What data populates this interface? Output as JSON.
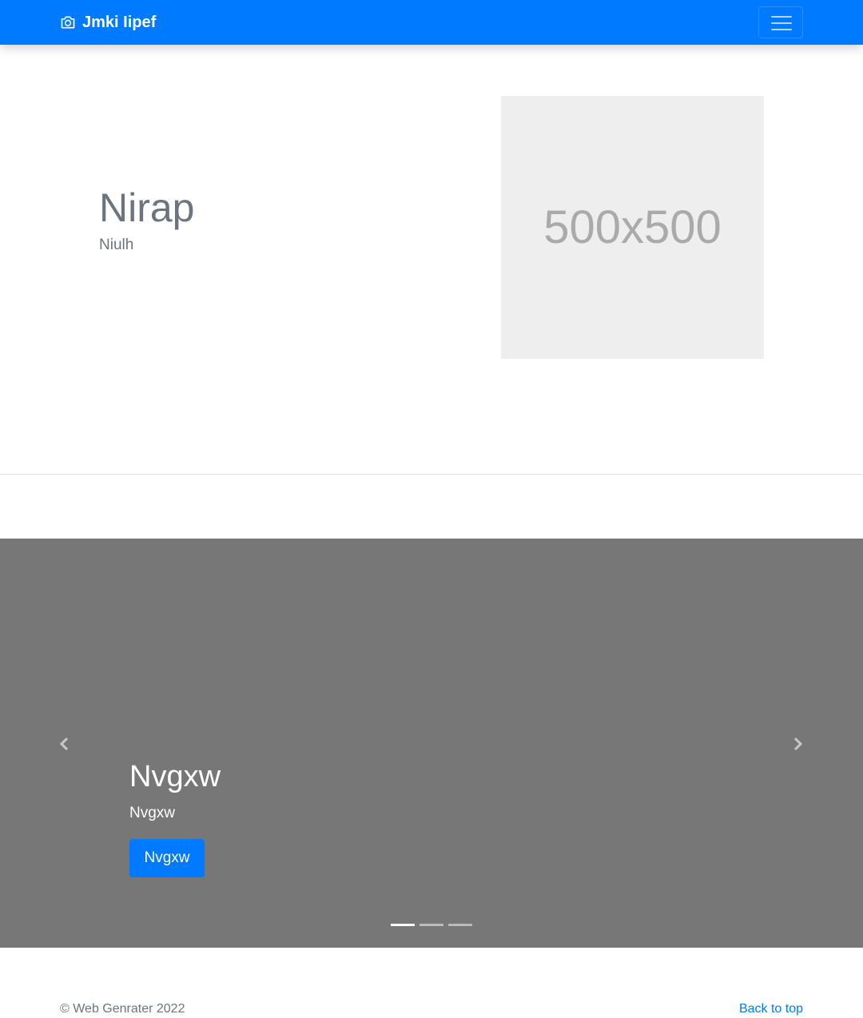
{
  "navbar": {
    "brand": "Jmki Iipef",
    "brand_icon": "camera-icon",
    "toggler_icon": "hamburger-menu-icon",
    "background": "#007bff"
  },
  "hero": {
    "title": "Nirap",
    "subtitle": "Niulh",
    "image_label": "500x500"
  },
  "carousel": {
    "background": "#777777",
    "slide": {
      "title": "Nvgxw",
      "subtitle": "Nvgxw",
      "button_label": "Nvgxw"
    },
    "prev_icon": "chevron-left-icon",
    "next_icon": "chevron-right-icon",
    "indicator_count": 3,
    "active_index": 0
  },
  "footer": {
    "copyright": "© Web Genrater 2022",
    "back_to_top": "Back to top",
    "link_color": "#007bff"
  }
}
